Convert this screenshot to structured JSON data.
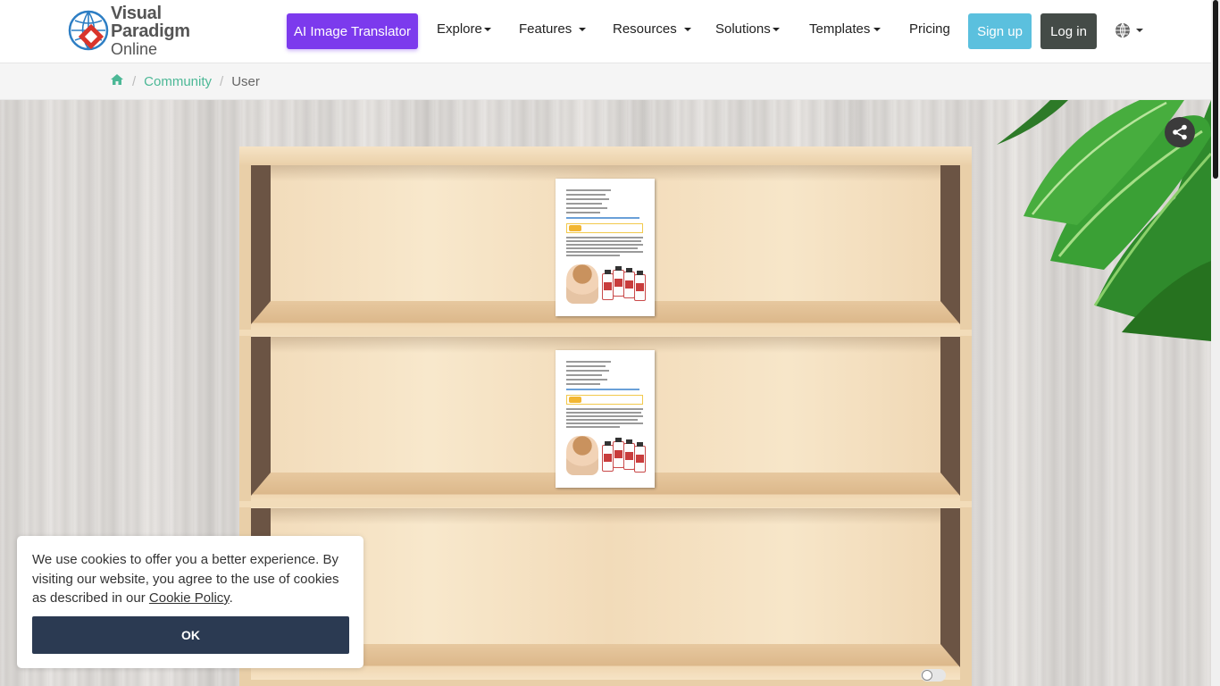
{
  "header": {
    "logo_line1": "Visual Paradigm",
    "logo_line2": "Online",
    "cta_label": "AI Image Translator",
    "nav_items": [
      "Explore",
      "Features",
      "Resources",
      "Solutions",
      "Templates",
      "Pricing"
    ],
    "signup_label": "Sign up",
    "login_label": "Log in",
    "language_icon": "globe-icon"
  },
  "breadcrumb": {
    "home_icon": "home-icon",
    "items": [
      "Community",
      "User"
    ]
  },
  "bookshelf": {
    "shelves": [
      {
        "books": 1
      },
      {
        "books": 1
      },
      {
        "books": 0
      }
    ],
    "share_icon": "share-icon"
  },
  "cookie": {
    "text_before_link": "We use cookies to offer you a better experience. By visiting our website, you agree to the use of cookies as described in our ",
    "link_label": "Cookie Policy",
    "text_after_link": ".",
    "ok_label": "OK"
  },
  "colors": {
    "cta": "#7c3aed",
    "signup": "#5bc0de",
    "login": "#444b47",
    "breadcrumb_link": "#4cb896",
    "cookie_button": "#2b3a52"
  }
}
